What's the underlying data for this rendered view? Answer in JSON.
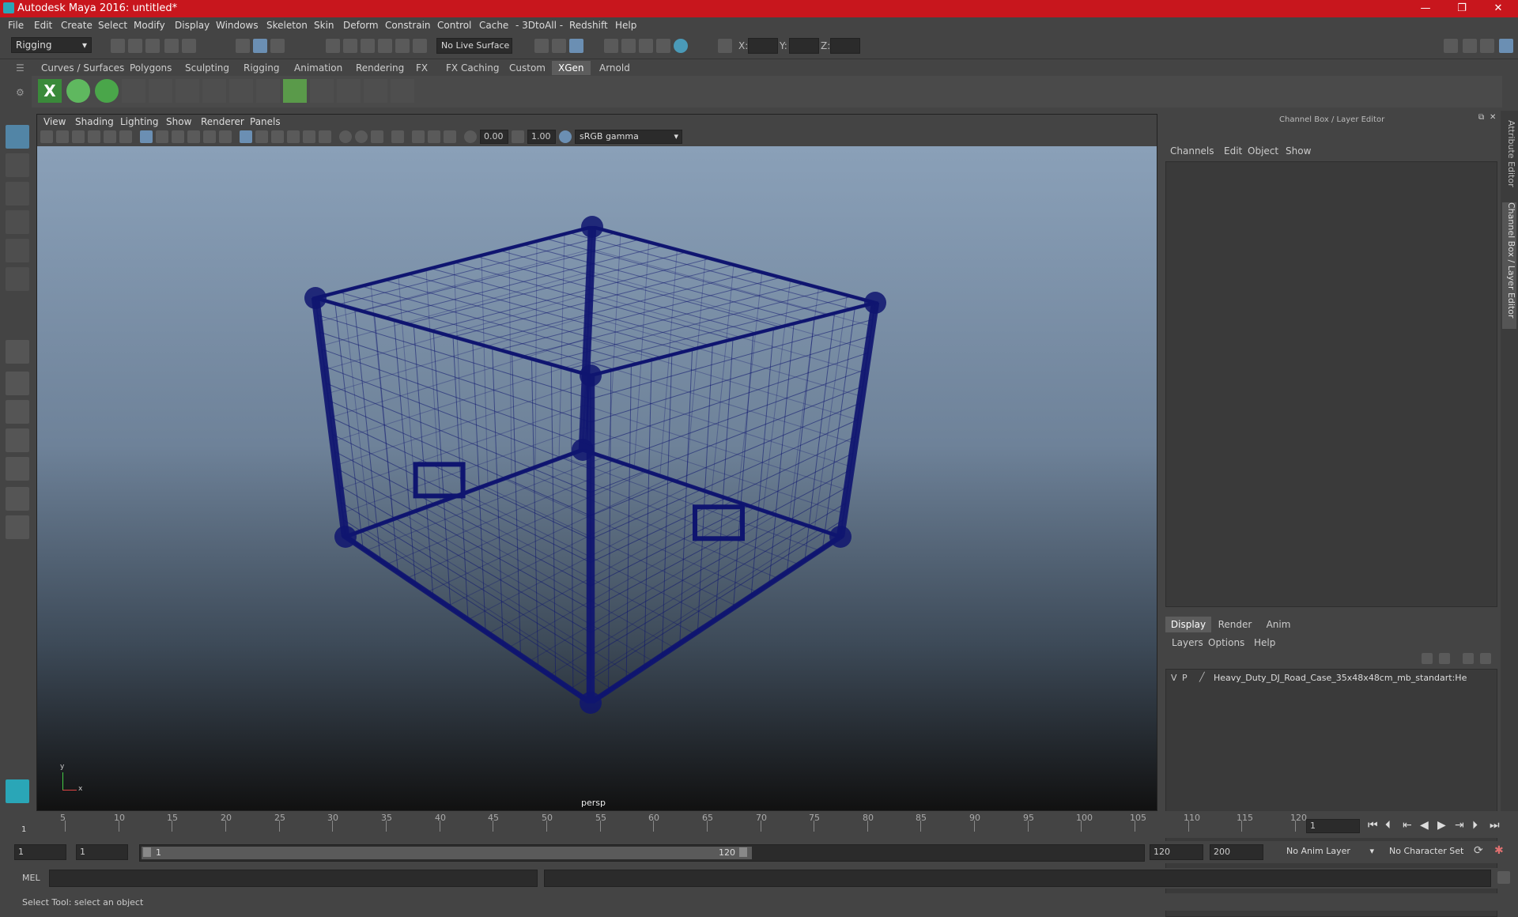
{
  "titlebar": {
    "title": "Autodesk Maya 2016: untitled*",
    "minimize": "—",
    "maximize": "❐",
    "close": "✕"
  },
  "menus": [
    "File",
    "Edit",
    "Create",
    "Select",
    "Modify",
    "Display",
    "Windows",
    "Skeleton",
    "Skin",
    "Deform",
    "Constrain",
    "Control",
    "Cache",
    "- 3DtoAll -",
    "Redshift",
    "Help"
  ],
  "statusline": {
    "mode": "Rigging",
    "live_surface": "No Live Surface",
    "x_label": "X:",
    "y_label": "Y:",
    "z_label": "Z:"
  },
  "shelf_tabs": [
    "Curves / Surfaces",
    "Polygons",
    "Sculpting",
    "Rigging",
    "Animation",
    "Rendering",
    "FX",
    "FX Caching",
    "Custom",
    "XGen",
    "Arnold"
  ],
  "shelf_active": "XGen",
  "viewport": {
    "menus": [
      "View",
      "Shading",
      "Lighting",
      "Show",
      "Renderer",
      "Panels"
    ],
    "exposure": "0.00",
    "gamma": "1.00",
    "color_space": "sRGB gamma",
    "camera": "persp",
    "wire_color": "#0f1570",
    "axis": {
      "x": "x",
      "y": "y"
    }
  },
  "channelbox": {
    "title": "Channel Box / Layer Editor",
    "menus": [
      "Channels",
      "Edit",
      "Object",
      "Show"
    ]
  },
  "layer_editor": {
    "tabs": [
      "Display",
      "Render",
      "Anim"
    ],
    "active_tab": "Display",
    "menus": [
      "Layers",
      "Options",
      "Help"
    ],
    "layers": [
      {
        "v": "V",
        "p": "P",
        "name": "Heavy_Duty_DJ_Road_Case_35x48x48cm_mb_standart:He"
      }
    ]
  },
  "side_tabs": [
    "Attribute Editor",
    "Channel Box / Layer Editor"
  ],
  "timeslider": {
    "ticks": [
      "5",
      "10",
      "15",
      "20",
      "25",
      "30",
      "35",
      "40",
      "45",
      "50",
      "55",
      "60",
      "65",
      "70",
      "75",
      "80",
      "85",
      "90",
      "95",
      "100",
      "105",
      "110",
      "115",
      "120"
    ],
    "start_marker": "1",
    "current_frame": "1"
  },
  "range": {
    "start": "1",
    "anim_start": "1",
    "slider_start": "1",
    "slider_end": "120",
    "end": "120",
    "anim_end": "200",
    "anim_layer": "No Anim Layer",
    "char_set": "No Character Set"
  },
  "cmdline": {
    "lang": "MEL"
  },
  "helpline": {
    "text": "Select Tool: select an object"
  },
  "colors": {
    "titlebar": "#c8161d",
    "accent": "#5285a6",
    "viewport_top": "#8aa0b8",
    "viewport_bottom": "#111111"
  }
}
